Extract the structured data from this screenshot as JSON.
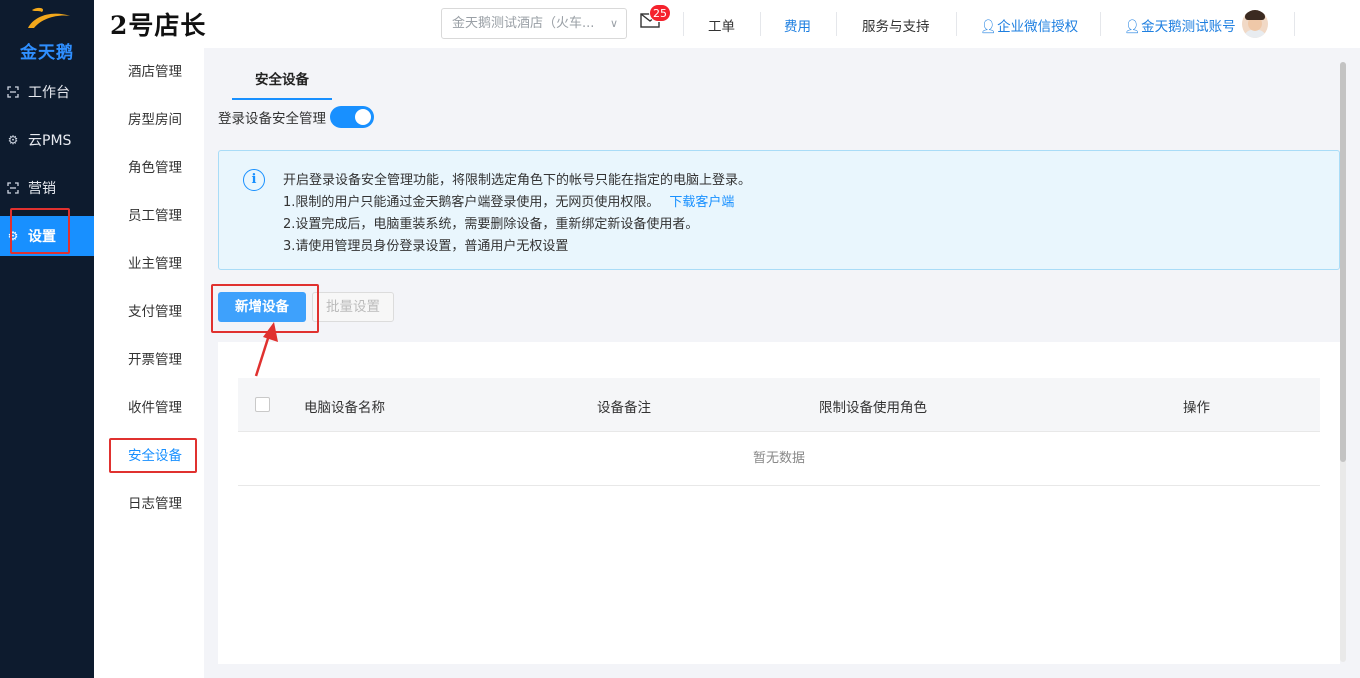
{
  "brand": {
    "logo_text": "金天鹅",
    "title": "2号店长"
  },
  "leftnav": {
    "items": [
      {
        "label": "工作台",
        "icon": "bracket-icon"
      },
      {
        "label": "云PMS",
        "icon": "gear-icon"
      },
      {
        "label": "营销",
        "icon": "bracket-icon"
      },
      {
        "label": "设置",
        "icon": "gear-icon",
        "active": true
      }
    ]
  },
  "header": {
    "hotel_select": "金天鹅测试酒店（火车...",
    "mail_badge": "25",
    "links": {
      "tickets": "工单",
      "fees": "费用",
      "service": "服务与支持",
      "wechat": "企业微信授权",
      "account": "金天鹅测试账号"
    }
  },
  "submenu": {
    "items": [
      {
        "label": "酒店管理"
      },
      {
        "label": "房型房间"
      },
      {
        "label": "角色管理"
      },
      {
        "label": "员工管理"
      },
      {
        "label": "业主管理"
      },
      {
        "label": "支付管理"
      },
      {
        "label": "开票管理"
      },
      {
        "label": "收件管理"
      },
      {
        "label": "安全设备",
        "active": true
      },
      {
        "label": "日志管理"
      }
    ]
  },
  "main": {
    "tab": "安全设备",
    "toggle": {
      "label": "登录设备安全管理",
      "on": true
    },
    "notice": {
      "line1": "开启登录设备安全管理功能，将限制选定角色下的帐号只能在指定的电脑上登录。",
      "line2": "1.限制的用户只能通过金天鹅客户端登录使用，无网页使用权限。",
      "line2_link": "下载客户端",
      "line3": "2.设置完成后，电脑重装系统，需要删除设备，重新绑定新设备使用者。",
      "line4": "3.请使用管理员身份登录设置，普通用户无权设置"
    },
    "buttons": {
      "add": "新增设备",
      "batch": "批量设置"
    },
    "table": {
      "columns": [
        "电脑设备名称",
        "设备备注",
        "限制设备使用角色",
        "操作"
      ],
      "empty_text": "暂无数据"
    }
  },
  "colors": {
    "primary": "#1890ff",
    "nav_bg": "#0d1b2e",
    "highlight": "#e0312f"
  }
}
